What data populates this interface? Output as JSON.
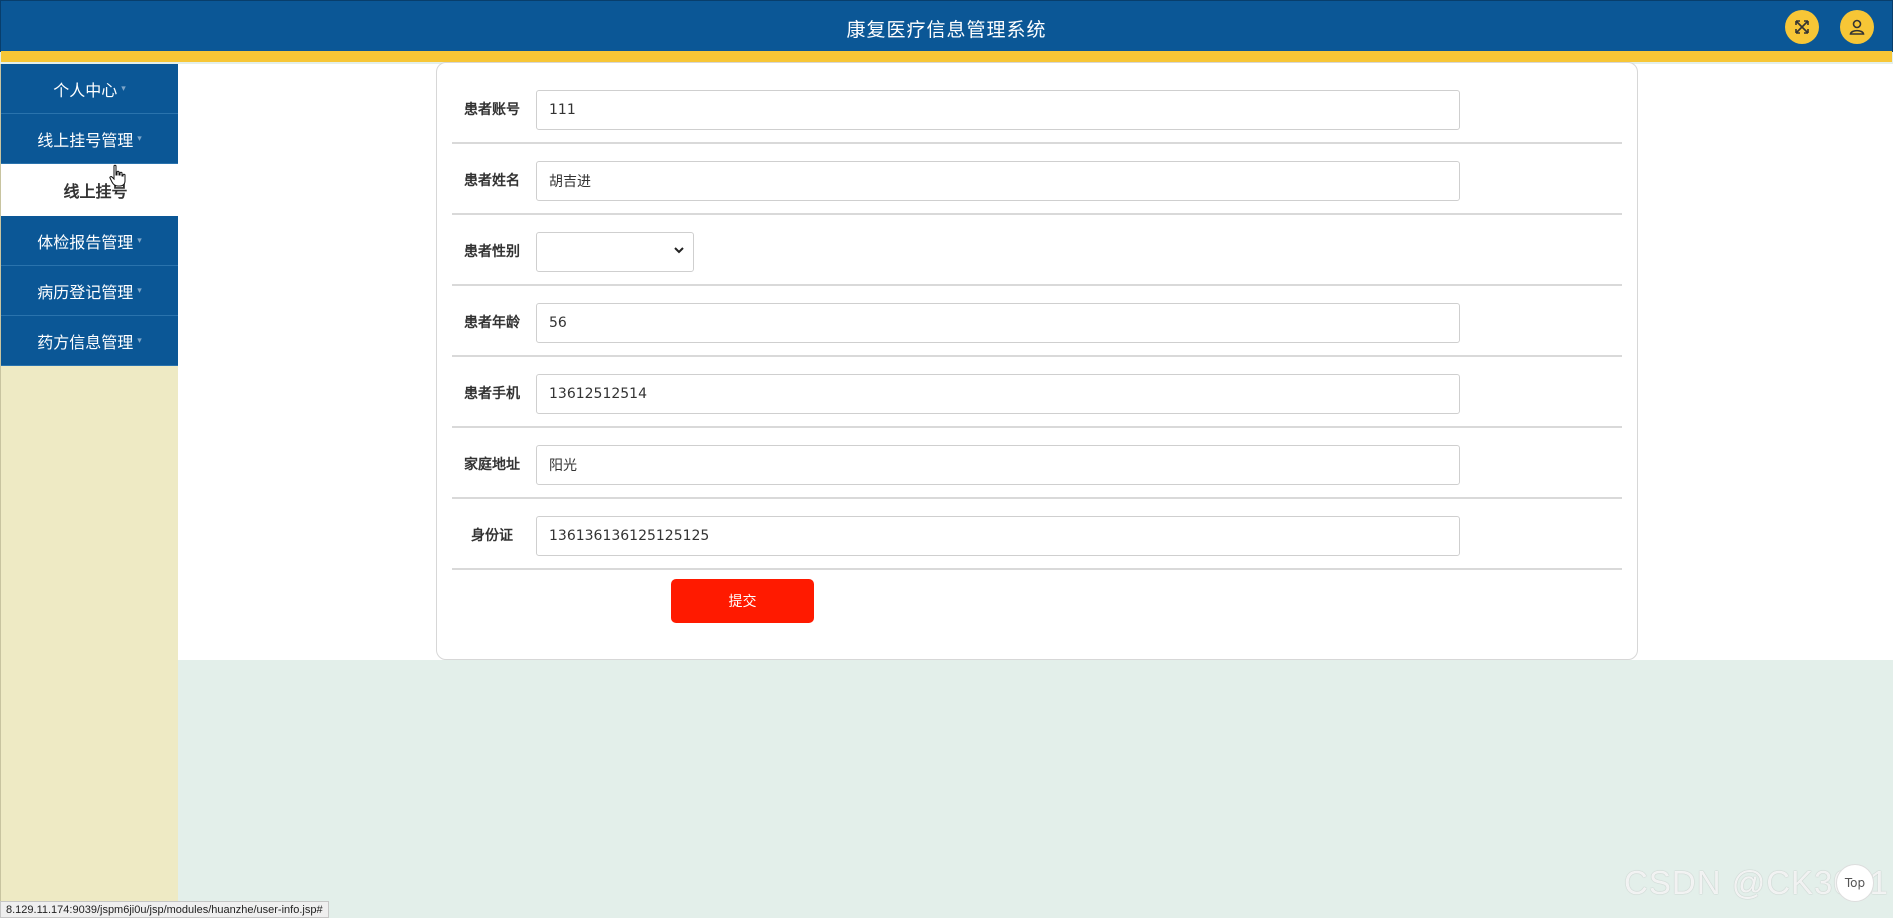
{
  "header": {
    "title": "康复医疗信息管理系统",
    "buttons": [
      {
        "icon": "fullscreen-icon"
      },
      {
        "icon": "user-icon"
      }
    ]
  },
  "sidebar": {
    "items": [
      {
        "label": "个人中心"
      },
      {
        "label": "线上挂号管理"
      },
      {
        "label": "线上挂号",
        "sub": true
      },
      {
        "label": "体检报告管理"
      },
      {
        "label": "病历登记管理"
      },
      {
        "label": "药方信息管理"
      }
    ]
  },
  "form": {
    "fields": [
      {
        "label": "患者账号",
        "value": "111"
      },
      {
        "label": "患者姓名",
        "value": "胡吉进"
      },
      {
        "label": "患者性别",
        "value": ""
      },
      {
        "label": "患者年龄",
        "value": "56"
      },
      {
        "label": "患者手机",
        "value": "13612512514"
      },
      {
        "label": "家庭地址",
        "value": "阳光"
      },
      {
        "label": "身份证",
        "value": "136136136125125125"
      }
    ],
    "submit_label": "提交"
  },
  "status_url": "8.129.11.174:9039/jspm6ji0u/jsp/modules/huanzhe/user-info.jsp#",
  "watermark": "CSDN @CK3011",
  "back_to_top": "Top",
  "colors": {
    "header": "#0b5796",
    "accent_stripe": "#f7c636",
    "submit": "#ff1a00",
    "sidebar_bg": "#eeeac4"
  }
}
